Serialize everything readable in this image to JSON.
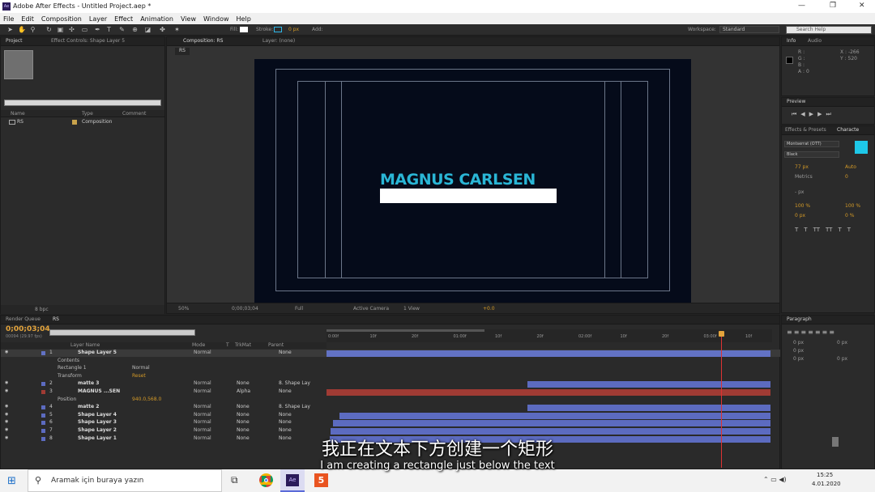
{
  "title": "Adobe After Effects - Untitled Project.aep *",
  "app_icon_label": "Ae",
  "menu": [
    "File",
    "Edit",
    "Composition",
    "Layer",
    "Effect",
    "Animation",
    "View",
    "Window",
    "Help"
  ],
  "toolbar": {
    "fill_label": "Fill:",
    "stroke_label": "Stroke:",
    "stroke_px": "0 px",
    "add_label": "Add:",
    "workspace_label": "Workspace:",
    "workspace_value": "Standard",
    "search_placeholder": "Search Help"
  },
  "project_panel": {
    "tab_project": "Project",
    "tab_effect": "Effect Controls: Shape Layer 5",
    "col_name": "Name",
    "col_type": "Type",
    "col_comment": "Comment",
    "item_name": "RS",
    "item_type": "Composition",
    "bpc": "8 bpc"
  },
  "comp_panel": {
    "tab": "Composition: RS",
    "layer_tab": "Layer: (none)",
    "breadcrumb": "RS",
    "zoom": "50%",
    "timecode": "0;00;03;04",
    "resolution": "Full",
    "camera": "Active Camera",
    "view": "1 View",
    "exposure": "+0.0"
  },
  "comp_text": {
    "title_text": "MAGNUS CARLSEN",
    "title_color": "#2ab6d6",
    "bg_color": "#050b1a"
  },
  "info_panel": {
    "tab_info": "Info",
    "tab_audio": "Audio",
    "r": "R :",
    "g": "G :",
    "b": "B :",
    "a": "A : 0",
    "x": "X : -266",
    "y": "Y : 520"
  },
  "preview_panel": {
    "tab": "Preview"
  },
  "char_panel": {
    "tab_effects": "Effects & Presets",
    "tab_char": "Characte",
    "font": "Montserrat (OTT)",
    "style": "Black",
    "size": "77 px",
    "leading": "Auto",
    "kerning": "Metrics",
    "tracking": "0",
    "stroke_px": "- px",
    "vscale": "100 %",
    "hscale": "100 %",
    "baseline": "0 px",
    "tsume": "0 %",
    "styles": [
      "T",
      "T",
      "TT",
      "TT",
      "T",
      "T",
      "T"
    ],
    "fill_color": "#1ec8e8"
  },
  "paragraph_panel": {
    "tab": "Paragraph",
    "vals": [
      "0 px",
      "0 px",
      "0 px",
      "0 px",
      "0 px"
    ]
  },
  "timeline": {
    "tab_render": "Render Queue",
    "tab_rs": "RS",
    "timecode": "0;00;03;04",
    "frames": "00094 (29.97 fps)",
    "cols": {
      "layer_name": "Layer Name",
      "mode": "Mode",
      "t": "T",
      "trkmat": "TrkMat",
      "parent": "Parent"
    },
    "ruler": [
      "0:00f",
      "10f",
      "20f",
      "01:00f",
      "10f",
      "20f",
      "02:00f",
      "10f",
      "20f",
      "03:00f",
      "10f"
    ],
    "layers": [
      {
        "num": "1",
        "name": "Shape Layer 5",
        "mode": "Normal",
        "trk": "",
        "parent": "None",
        "color": "#6272c4"
      },
      {
        "num": "",
        "name": "Contents",
        "mode": "",
        "trk": "",
        "parent": "",
        "color": ""
      },
      {
        "num": "",
        "name": "Rectangle 1",
        "mode": "Normal",
        "trk": "",
        "parent": "",
        "color": ""
      },
      {
        "num": "",
        "name": "Transform",
        "mode": "Reset",
        "trk": "",
        "parent": "",
        "color": ""
      },
      {
        "num": "2",
        "name": "matte 3",
        "mode": "Normal",
        "trk": "None",
        "parent": "8. Shape Lay",
        "color": "#5c6bc0"
      },
      {
        "num": "3",
        "name": "MAGNUS ...SEN",
        "mode": "Normal",
        "trk": "Alpha",
        "parent": "None",
        "color": "#a03b34"
      },
      {
        "num": "",
        "name": "Position",
        "mode": "940.0,568.0",
        "trk": "",
        "parent": "",
        "color": ""
      },
      {
        "num": "4",
        "name": "matte 2",
        "mode": "Normal",
        "trk": "None",
        "parent": "8. Shape Lay",
        "color": "#5c6bc0"
      },
      {
        "num": "5",
        "name": "Shape Layer 4",
        "mode": "Normal",
        "trk": "None",
        "parent": "None",
        "color": "#5c6bc0"
      },
      {
        "num": "6",
        "name": "Shape Layer 3",
        "mode": "Normal",
        "trk": "None",
        "parent": "None",
        "color": "#5c6bc0"
      },
      {
        "num": "7",
        "name": "Shape Layer 2",
        "mode": "Normal",
        "trk": "None",
        "parent": "None",
        "color": "#5c6bc0"
      },
      {
        "num": "8",
        "name": "Shape Layer 1",
        "mode": "Normal",
        "trk": "None",
        "parent": "None",
        "color": "#5c6bc0"
      }
    ],
    "add_label": "Add:"
  },
  "subtitles": {
    "zh": "我正在文本下方创建一个矩形",
    "en": "I am creating a rectangle just below the text"
  },
  "taskbar": {
    "search_placeholder": "Aramak için buraya yazın",
    "time": "15:25",
    "date": "4.01.2020"
  }
}
